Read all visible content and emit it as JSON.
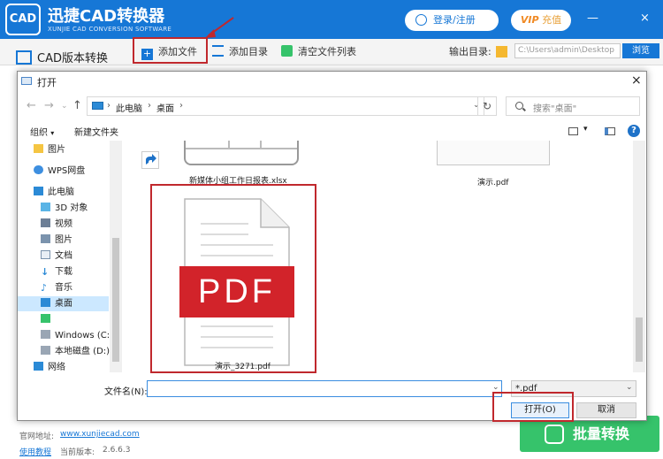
{
  "app": {
    "logo_text": "CAD",
    "title": "迅捷CAD转换器",
    "subtitle": "XUNJIE CAD CONVERSION SOFTWARE",
    "login_label": "登录/注册",
    "vip_prefix": "VIP",
    "vip_label": "充值",
    "window_controls": [
      "—",
      "×"
    ]
  },
  "toolbar": {
    "add_file_label": "添加文件",
    "add_folder_label": "添加目录",
    "clear_list_label": "清空文件列表",
    "output_dir_label": "输出目录:",
    "output_dir_value": "C:\\Users\\admin\\Desktop",
    "browse_label": "浏览"
  },
  "sidebar": {
    "cad_convert_label": "CAD版本转换"
  },
  "footer": {
    "website_prefix": "官网地址:",
    "website_url": "www.xunjiecad.com",
    "tutorial_label": "使用教程",
    "version_prefix": "当前版本:",
    "version_value": "2.6.6.3",
    "batch_convert_label": "批量转换"
  },
  "dialog": {
    "title": "打开",
    "close_glyph": "×",
    "breadcrumb": [
      "此电脑",
      "桌面"
    ],
    "search_placeholder": "搜索\"桌面\"",
    "organize_label": "组织",
    "new_folder_label": "新建文件夹",
    "nav_items": [
      {
        "label": "图片",
        "icon": "folder-icon"
      },
      {
        "label": "WPS网盘",
        "icon": "cloud-icon"
      },
      {
        "label": "此电脑",
        "icon": "computer-icon"
      },
      {
        "label": "3D 对象",
        "icon": "cube-icon"
      },
      {
        "label": "视频",
        "icon": "video-icon"
      },
      {
        "label": "图片",
        "icon": "picture-icon"
      },
      {
        "label": "文档",
        "icon": "document-icon"
      },
      {
        "label": "下载",
        "icon": "download-icon"
      },
      {
        "label": "音乐",
        "icon": "music-icon"
      },
      {
        "label": "桌面",
        "icon": "desktop-icon"
      },
      {
        "label": "Windows (C:)",
        "icon": "drive-icon"
      },
      {
        "label": "本地磁盘 (D:)",
        "icon": "drive-icon"
      },
      {
        "label": "网络",
        "icon": "network-icon"
      }
    ],
    "files": [
      {
        "name": "新媒体小组工作日报表.xlsx"
      },
      {
        "name": "演示.pdf"
      },
      {
        "name": "演示_3271.pdf",
        "badge": "PDF"
      }
    ],
    "filename_label": "文件名(N):",
    "filename_value": "",
    "filetype_value": "*.pdf",
    "open_label": "打开(O)",
    "cancel_label": "取消"
  },
  "colors": {
    "brand_blue": "#1677d6",
    "highlight_red": "#c0282d",
    "pdf_red": "#d2232a",
    "convert_green": "#36c36b"
  }
}
